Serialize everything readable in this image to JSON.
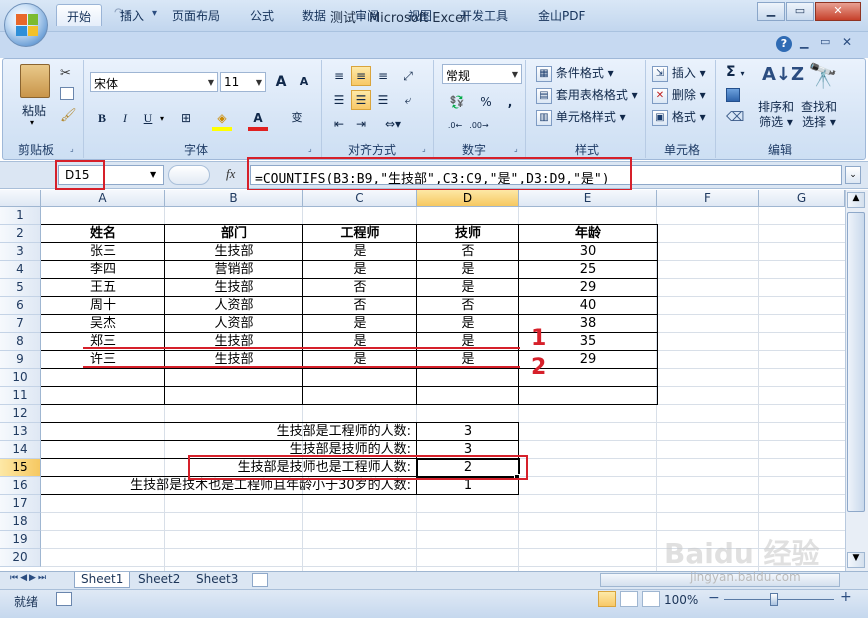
{
  "window": {
    "title": "测试 - Microsoft Excel"
  },
  "tabs": [
    "开始",
    "插入",
    "页面布局",
    "公式",
    "数据",
    "审阅",
    "视图",
    "开发工具",
    "金山PDF"
  ],
  "ribbon": {
    "clipboard": {
      "paste": "粘贴",
      "label": "剪贴板"
    },
    "font": {
      "name": "宋体",
      "size": "11",
      "label": "字体",
      "big_a": "A",
      "small_a": "A",
      "bold": "B",
      "italic": "I",
      "underline": "U",
      "wen": "变"
    },
    "alignment": {
      "label": "对齐方式"
    },
    "number": {
      "format": "常规",
      "label": "数字",
      "percent": "%",
      "comma": ","
    },
    "styles": {
      "conditional": "条件格式",
      "table": "套用表格格式",
      "cell": "单元格样式",
      "label": "样式"
    },
    "cells": {
      "insert": "插入",
      "delete": "删除",
      "format": "格式",
      "label": "单元格"
    },
    "editing": {
      "sigma": "Σ",
      "sort": "排序和\n筛选",
      "sort1": "排序和",
      "sort2": "筛选",
      "find1": "查找和",
      "find2": "选择",
      "label": "编辑"
    }
  },
  "formula_bar": {
    "namebox": "D15",
    "fx": "fx",
    "formula": "=COUNTIFS(B3:B9,\"生技部\",C3:C9,\"是\",D3:D9,\"是\")"
  },
  "columns": [
    "A",
    "B",
    "C",
    "D",
    "E",
    "F",
    "G"
  ],
  "rows": [
    "1",
    "2",
    "3",
    "4",
    "5",
    "6",
    "7",
    "8",
    "9",
    "10",
    "11",
    "12",
    "13",
    "14",
    "15",
    "16",
    "17",
    "18",
    "19",
    "20"
  ],
  "table": {
    "headers": [
      "姓名",
      "部门",
      "工程师",
      "技师",
      "年龄"
    ],
    "rows": [
      [
        "张三",
        "生技部",
        "是",
        "否",
        "30"
      ],
      [
        "李四",
        "营销部",
        "是",
        "是",
        "25"
      ],
      [
        "王五",
        "生技部",
        "否",
        "是",
        "29"
      ],
      [
        "周十",
        "人资部",
        "否",
        "否",
        "40"
      ],
      [
        "吴杰",
        "人资部",
        "是",
        "是",
        "38"
      ],
      [
        "郑三",
        "生技部",
        "是",
        "是",
        "35"
      ],
      [
        "许三",
        "生技部",
        "是",
        "是",
        "29"
      ]
    ]
  },
  "summary": [
    {
      "label": "生技部是工程师的人数:",
      "value": "3"
    },
    {
      "label": "生技部是技师的人数:",
      "value": "3"
    },
    {
      "label": "生技部是技师也是工程师人数:",
      "value": "2"
    },
    {
      "label": "生技部是技术也是工程师且年龄小于30岁的人数:",
      "value": "1"
    }
  ],
  "annotations": [
    "1",
    "2"
  ],
  "sheets": [
    "Sheet1",
    "Sheet2",
    "Sheet3"
  ],
  "status": {
    "ready": "就绪",
    "zoom": "100%",
    "minus": "−",
    "plus": "+"
  },
  "watermark": {
    "line1": "Baidu 经验",
    "line2": "jingyan.baidu.com"
  },
  "colors": {
    "accent_red": "#d6202a",
    "selected_header": "#f6c861"
  }
}
